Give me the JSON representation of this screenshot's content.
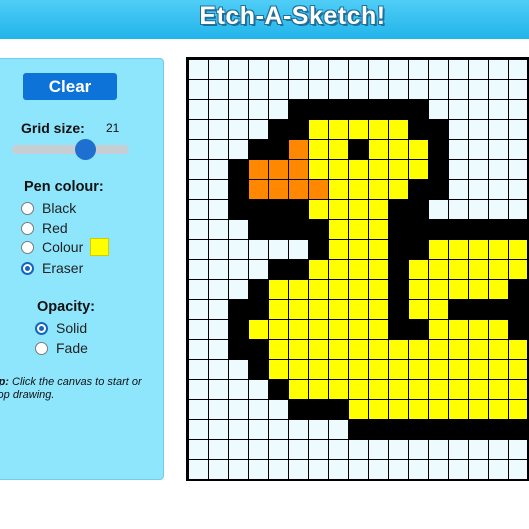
{
  "header": {
    "title": "Etch-A-Sketch!"
  },
  "controls": {
    "clear_label": "Clear",
    "grid_size_label": "Grid size:",
    "grid_size_value": "21",
    "slider_fraction": 0.62,
    "pen_title": "Pen colour:",
    "pen_options": [
      "Black",
      "Red",
      "Colour",
      "Eraser"
    ],
    "pen_selected": "Eraser",
    "colour_swatch": "#ffff00",
    "opacity_title": "Opacity:",
    "opacity_options": [
      "Solid",
      "Fade"
    ],
    "opacity_selected": "Solid",
    "tip_prefix": "Tip:",
    "tip_text": "Click the canvas to start or stop drawing."
  },
  "canvas": {
    "grid_size": 21,
    "palette": {
      ".": "#eefbfe",
      "K": "#000000",
      "Y": "#ffff00",
      "O": "#ff8800"
    },
    "rows": [
      ".....................",
      ".....................",
      ".....KKKKKKK.........",
      "....KKYYYYYKK........",
      "...KKOYYKYYYK........",
      "..KOOOYYYYYYK........",
      "..KOOOOYYYYKK........",
      "..KKKKYYYYKK.........",
      "...KKKKYYYKKKKKKKKKKK",
      "......KYYYKKYYYYYYKKK",
      "....KKYYYYKYYYYYYYYKK",
      "...KYYYYYYKYYYYYKYYYK",
      "..KKYYYYYYKYYKKKKYYYK",
      "..KYYYYYYYKKYYYYKYYYK",
      "..KKYYYYYYYYYYYYYYYYK",
      "...KYYYYYYYYYYYYYYYYK",
      "....KYYYYYYYYYYYYYYYK",
      ".....KKKYYYYYYYYYYKKK",
      "........KKKKKKKKKK...",
      ".....................",
      "....................."
    ]
  }
}
